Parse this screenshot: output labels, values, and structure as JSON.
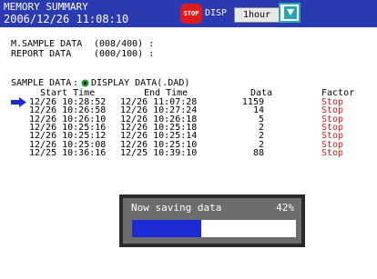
{
  "header": {
    "title": "MEMORY SUMMARY",
    "datetime": "2006/12/26 11:08:10",
    "status_badge": "STOP",
    "mode": "DISP",
    "interval": "1hour",
    "icon": "sd-card-icon"
  },
  "summary": {
    "m_sample_label": "M.SAMPLE DATA",
    "m_sample_value": "(008/400) :",
    "report_label": "REPORT DATA",
    "report_value": "(000/100) :"
  },
  "sample": {
    "label": "SAMPLE DATA",
    "separator": ":",
    "display_label": "DISPLAY DATA(.DAD)"
  },
  "table": {
    "headers": [
      "Start Time",
      "End Time",
      "Data",
      "Factor"
    ],
    "rows": [
      {
        "start": "12/26 10:28:52",
        "end": "12/26 11:07:28",
        "data": "1159",
        "factor": "Stop"
      },
      {
        "start": "12/26 10:26:58",
        "end": "12/26 10:27:24",
        "data": "14",
        "factor": "Stop"
      },
      {
        "start": "12/26 10:26:10",
        "end": "12/26 10:26:18",
        "data": "5",
        "factor": "Stop"
      },
      {
        "start": "12/26 10:25:16",
        "end": "12/26 10:25:18",
        "data": "2",
        "factor": "Stop"
      },
      {
        "start": "12/26 10:25:12",
        "end": "12/26 10:25:14",
        "data": "2",
        "factor": "Stop"
      },
      {
        "start": "12/26 10:25:08",
        "end": "12/26 10:25:10",
        "data": "2",
        "factor": "Stop"
      },
      {
        "start": "12/25 10:36:16",
        "end": "12/25 10:39:10",
        "data": "88",
        "factor": "Stop"
      }
    ]
  },
  "dialog": {
    "message": "Now saving data",
    "percent_label": "42%",
    "progress": 0.42
  },
  "colors": {
    "header_bg": "#2a3ab0",
    "factor": "#e01a1a",
    "progress_fill": "#1c2bd6",
    "dialog_bg": "#6d6d6d",
    "arrow": "#1c2bd6",
    "radio": "#1a9e2a"
  }
}
